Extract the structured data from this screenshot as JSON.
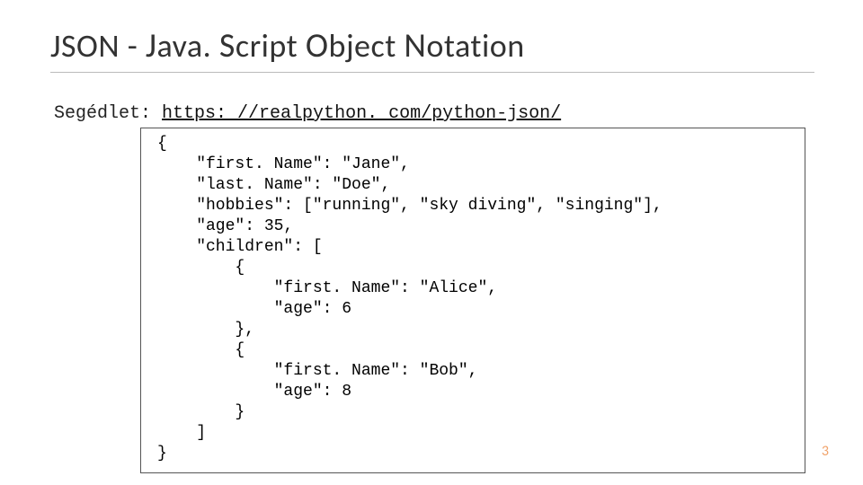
{
  "title": {
    "part1": "JSON - ",
    "j": "J",
    "ava": "ava. ",
    "s": "S",
    "cript": "cript ",
    "o": "O",
    "bject": "bject ",
    "n": "N",
    "otation": "otation"
  },
  "subline": {
    "label": "Segédlet: ",
    "link": "https: //realpython. com/python-json/"
  },
  "code": "{\n    \"first. Name\": \"Jane\",\n    \"last. Name\": \"Doe\",\n    \"hobbies\": [\"running\", \"sky diving\", \"singing\"],\n    \"age\": 35,\n    \"children\": [\n        {\n            \"first. Name\": \"Alice\",\n            \"age\": 6\n        },\n        {\n            \"first. Name\": \"Bob\",\n            \"age\": 8\n        }\n    ]\n}",
  "page_number": "3"
}
